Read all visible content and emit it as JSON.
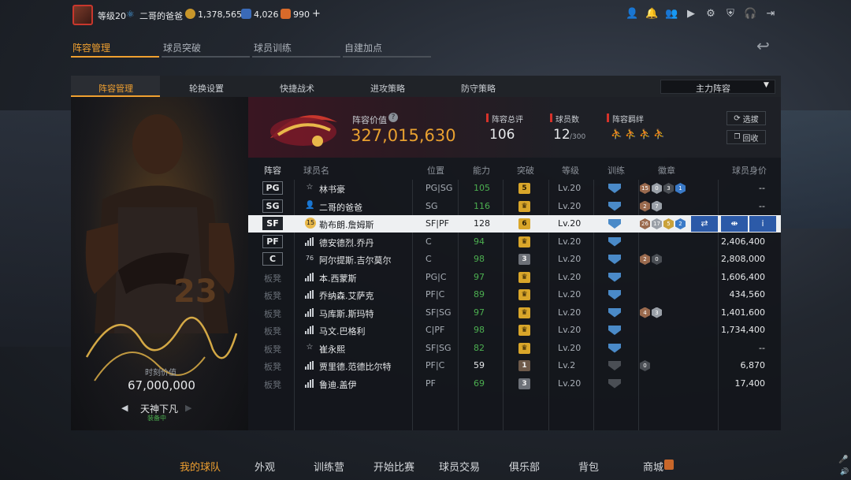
{
  "topbar": {
    "level": "等级20",
    "username": "二哥的爸爸",
    "coins": "1,378,565",
    "stars": "4,026",
    "tickets": "990",
    "plus": "+"
  },
  "main_tabs": [
    "阵容管理",
    "球员突破",
    "球员训练",
    "自建加点"
  ],
  "sub_tabs": [
    "阵容管理",
    "轮换设置",
    "快捷战术",
    "进攻策略",
    "防守策略"
  ],
  "lineup_select": "主力阵容",
  "card": {
    "value_label": "时刻价值",
    "value": "67,000,000",
    "name": "天神下凡",
    "status": "装备中",
    "jersey": "23"
  },
  "team": {
    "value_label": "阵容价值",
    "value": "327,015,630",
    "rating_label": "阵容总评",
    "rating": "106",
    "count_label": "球员数",
    "count": "12",
    "count_max": "/300",
    "bond_label": "阵容羁绊",
    "btn_select": "选拔",
    "btn_recycle": "回收"
  },
  "columns": [
    "阵容",
    "球员名",
    "位置",
    "能力",
    "突破",
    "等级",
    "训练",
    "徽章",
    "球员身价"
  ],
  "players": [
    {
      "slot": "PG",
      "slot_type": "starter",
      "icon": "star",
      "name": "林书豪",
      "pos": "PG|SG",
      "ability": "105",
      "ability_color": "#4caf50",
      "brk": "5",
      "brk_style": "gold",
      "level": "Lv.20",
      "train": true,
      "badges": [
        [
          "15",
          "b-bronze"
        ],
        [
          "0",
          "b-silver"
        ],
        [
          "3",
          "b-dark"
        ],
        [
          "1",
          "b-blue"
        ]
      ],
      "value": "--"
    },
    {
      "slot": "SG",
      "slot_type": "starter",
      "icon": "person",
      "name": "二哥的爸爸",
      "pos": "SG",
      "ability": "116",
      "ability_color": "#4caf50",
      "brk": "♛",
      "brk_style": "gold",
      "level": "Lv.20",
      "train": true,
      "badges": [
        [
          "2",
          "b-bronze"
        ],
        [
          "7",
          "b-silver"
        ]
      ],
      "value": "--"
    },
    {
      "slot": "SF",
      "slot_type": "selected",
      "icon": "rank15",
      "name": "勒布朗.詹姆斯",
      "pos": "SF|PF",
      "ability": "128",
      "ability_color": "#1a1c20",
      "brk": "6",
      "brk_style": "gold",
      "level": "Lv.20",
      "train": true,
      "badges": [
        [
          "26",
          "b-bronze"
        ],
        [
          "17",
          "b-silver"
        ],
        [
          "5",
          "b-gold"
        ],
        [
          "2",
          "b-blue"
        ]
      ],
      "value": ""
    },
    {
      "slot": "PF",
      "slot_type": "starter",
      "icon": "bars",
      "name": "德安德烈.乔丹",
      "pos": "C",
      "ability": "94",
      "ability_color": "#4caf50",
      "brk": "♛",
      "brk_style": "gold",
      "level": "Lv.20",
      "train": true,
      "badges": [],
      "value": "2,406,400"
    },
    {
      "slot": "C",
      "slot_type": "starter",
      "icon": "rank76",
      "name": "阿尔提斯.吉尔莫尔",
      "pos": "C",
      "ability": "98",
      "ability_color": "#4caf50",
      "brk": "3",
      "brk_style": "grey",
      "level": "Lv.20",
      "train": true,
      "badges": [
        [
          "2",
          "b-bronze"
        ],
        [
          "0",
          "b-dark"
        ]
      ],
      "value": "2,808,000"
    },
    {
      "slot": "板凳",
      "slot_type": "bench",
      "icon": "bars",
      "name": "本.西蒙斯",
      "pos": "PG|C",
      "ability": "97",
      "ability_color": "#4caf50",
      "brk": "♛",
      "brk_style": "gold",
      "level": "Lv.20",
      "train": true,
      "badges": [],
      "value": "1,606,400"
    },
    {
      "slot": "板凳",
      "slot_type": "bench",
      "icon": "bars",
      "name": "乔纳森.艾萨克",
      "pos": "PF|C",
      "ability": "89",
      "ability_color": "#4caf50",
      "brk": "♛",
      "brk_style": "gold",
      "level": "Lv.20",
      "train": true,
      "badges": [],
      "value": "434,560"
    },
    {
      "slot": "板凳",
      "slot_type": "bench",
      "icon": "bars",
      "name": "马库斯.斯玛特",
      "pos": "SF|SG",
      "ability": "97",
      "ability_color": "#4caf50",
      "brk": "♛",
      "brk_style": "gold",
      "level": "Lv.20",
      "train": true,
      "badges": [
        [
          "4",
          "b-bronze"
        ],
        [
          "3",
          "b-silver"
        ]
      ],
      "value": "1,401,600"
    },
    {
      "slot": "板凳",
      "slot_type": "bench",
      "icon": "bars",
      "name": "马文.巴格利",
      "pos": "C|PF",
      "ability": "98",
      "ability_color": "#4caf50",
      "brk": "♛",
      "brk_style": "gold",
      "level": "Lv.20",
      "train": true,
      "badges": [],
      "value": "1,734,400"
    },
    {
      "slot": "板凳",
      "slot_type": "bench",
      "icon": "star",
      "name": "崔永熙",
      "pos": "SF|SG",
      "ability": "82",
      "ability_color": "#4caf50",
      "brk": "♛",
      "brk_style": "gold",
      "level": "Lv.20",
      "train": true,
      "badges": [],
      "value": "--"
    },
    {
      "slot": "板凳",
      "slot_type": "bench",
      "icon": "bars",
      "name": "贾里德.范德比尔特",
      "pos": "PF|C",
      "ability": "59",
      "ability_color": "#e6e8ea",
      "brk": "1",
      "brk_style": "brown",
      "level": "Lv.2",
      "train": false,
      "badges": [
        [
          "0",
          "b-dark"
        ]
      ],
      "value": "6,870"
    },
    {
      "slot": "板凳",
      "slot_type": "bench",
      "icon": "bars",
      "name": "鲁迪.盖伊",
      "pos": "PF",
      "ability": "69",
      "ability_color": "#4caf50",
      "brk": "3",
      "brk_style": "grey",
      "level": "Lv.20",
      "train": false,
      "badges": [],
      "value": "17,400"
    }
  ],
  "bottom_nav": [
    "我的球队",
    "外观",
    "训练营",
    "开始比赛",
    "球员交易",
    "俱乐部",
    "背包",
    "商城"
  ]
}
